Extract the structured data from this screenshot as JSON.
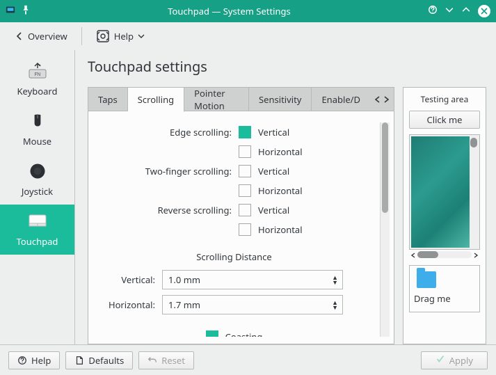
{
  "titlebar": {
    "title": "Touchpad  —  System Settings"
  },
  "topbar": {
    "overview": "Overview",
    "help": "Help"
  },
  "sidebar": {
    "items": [
      {
        "label": "Keyboard"
      },
      {
        "label": "Mouse"
      },
      {
        "label": "Joystick"
      },
      {
        "label": "Touchpad"
      }
    ]
  },
  "page": {
    "title": "Touchpad settings"
  },
  "tabs": {
    "items": [
      {
        "label": "Taps"
      },
      {
        "label": "Scrolling"
      },
      {
        "label": "Pointer Motion"
      },
      {
        "label": "Sensitivity"
      },
      {
        "label": "Enable/D"
      }
    ]
  },
  "form": {
    "edge_label": "Edge scrolling:",
    "twof_label": "Two-finger scrolling:",
    "rev_label": "Reverse scrolling:",
    "vertical": "Vertical",
    "horizontal": "Horizontal",
    "distance_head": "Scrolling Distance",
    "v_label": "Vertical:",
    "h_label": "Horizontal:",
    "v_val": "1.0 mm",
    "h_val": "1.7 mm",
    "coasting": "Coasting"
  },
  "test": {
    "title": "Testing area",
    "click": "Click me",
    "drag": "Drag me"
  },
  "footer": {
    "help": "Help",
    "defaults": "Defaults",
    "reset": "Reset",
    "apply": "Apply"
  }
}
